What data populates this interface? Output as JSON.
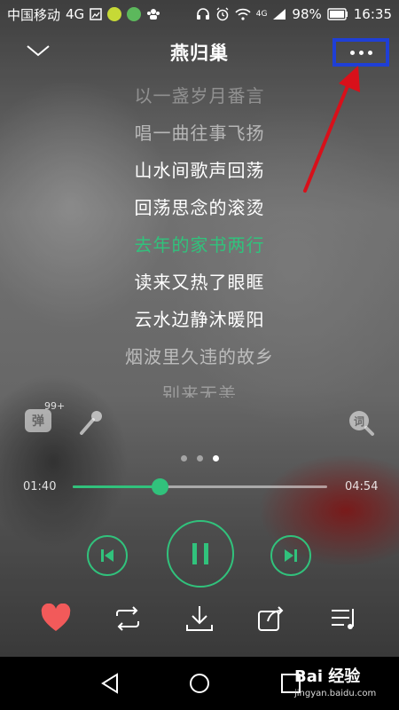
{
  "status_bar": {
    "carrier": "中国移动",
    "network": "4G",
    "signal_label": "4G",
    "battery": "98%",
    "time": "16:35"
  },
  "header": {
    "title": "燕归巢"
  },
  "lyrics": [
    {
      "text": "以一盏岁月番言",
      "state": "faint"
    },
    {
      "text": "唱一曲往事飞扬",
      "state": "dim"
    },
    {
      "text": "山水间歌声回荡",
      "state": "normal"
    },
    {
      "text": "回荡思念的滚烫",
      "state": "normal"
    },
    {
      "text": "去年的家书两行",
      "state": "active"
    },
    {
      "text": "读来又热了眼眶",
      "state": "normal"
    },
    {
      "text": "云水边静沐暖阳",
      "state": "normal"
    },
    {
      "text": "烟波里久违的故乡",
      "state": "dim"
    },
    {
      "text": "别来无恙",
      "state": "faint"
    }
  ],
  "tools": {
    "danmu_label": "弹",
    "danmu_count": "99+",
    "lyric_search_label": "词"
  },
  "pager": {
    "count": 3,
    "active": 2
  },
  "progress": {
    "current": "01:40",
    "total": "04:54",
    "fraction": 0.34
  },
  "watermark": {
    "brand": "Bai 经验",
    "url": "jingyan.baidu.com"
  },
  "colors": {
    "accent": "#31c27c",
    "like": "#f25a5a",
    "annotation": "#d8101a",
    "highlight_box": "#1f3fd6"
  }
}
